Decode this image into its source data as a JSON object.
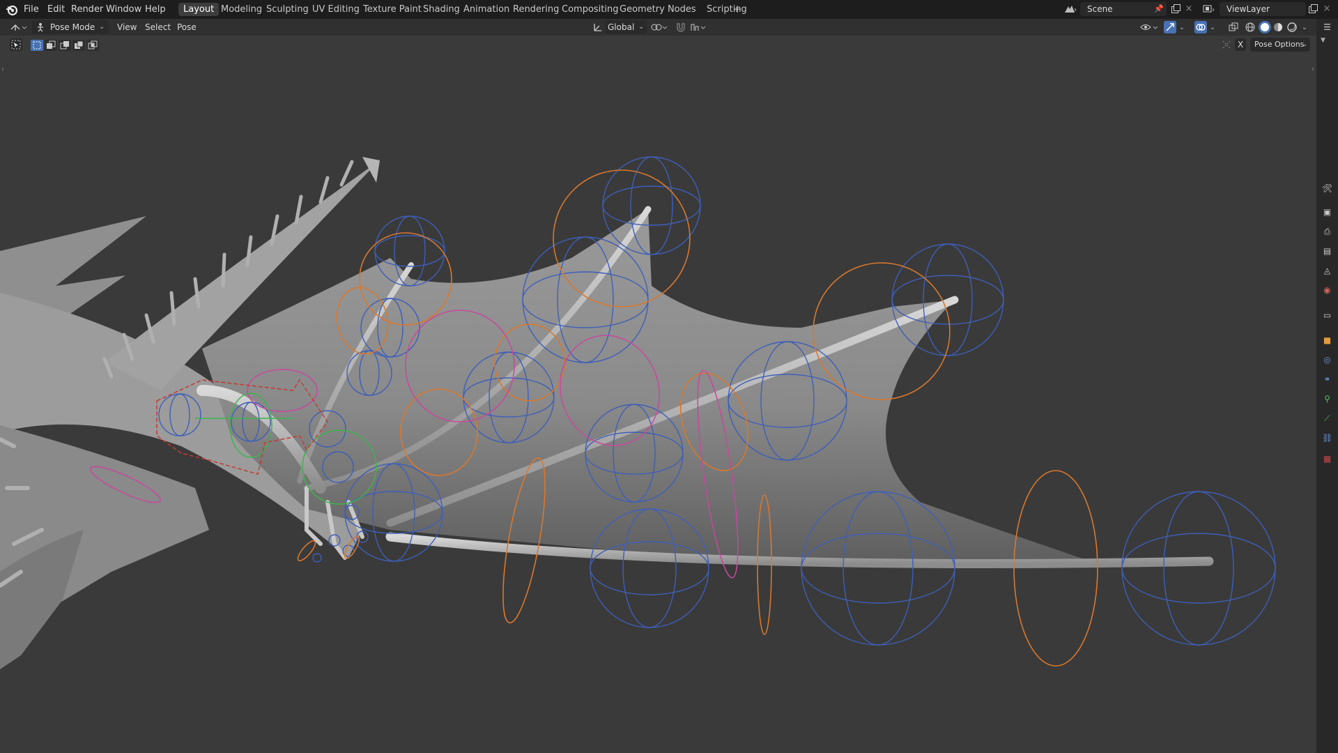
{
  "app": "Blender",
  "top_menu": [
    "File",
    "Edit",
    "Render",
    "Window",
    "Help"
  ],
  "workspaces": [
    {
      "label": "Layout",
      "active": true
    },
    {
      "label": "Modeling",
      "active": false
    },
    {
      "label": "Sculpting",
      "active": false
    },
    {
      "label": "UV Editing",
      "active": false
    },
    {
      "label": "Texture Paint",
      "active": false
    },
    {
      "label": "Shading",
      "active": false
    },
    {
      "label": "Animation",
      "active": false
    },
    {
      "label": "Rendering",
      "active": false
    },
    {
      "label": "Compositing",
      "active": false
    },
    {
      "label": "Geometry Nodes",
      "active": false
    },
    {
      "label": "Scripting",
      "active": false
    }
  ],
  "add_workspace_symbol": "+",
  "scene": {
    "label": "Scene"
  },
  "view_layer": {
    "label": "ViewLayer"
  },
  "header": {
    "mode": "Pose Mode",
    "menus": [
      "View",
      "Select",
      "Pose"
    ],
    "transform_orientation": "Global",
    "pose_options": "Pose Options",
    "x_mirror": "X"
  },
  "icons": {
    "blender_logo": "blender-logo-icon",
    "editor_type": "3d-viewport-icon",
    "pose_mode": "armature-pose-icon",
    "pivot": "transform-pivot-icon",
    "snap": "snap-magnet-icon",
    "proportional": "proportional-edit-icon",
    "visibility": "eye-icon",
    "gizmo": "gizmo-icon",
    "overlays": "overlay-icon",
    "xray": "xray-icon",
    "shading": [
      "wireframe-shading-icon",
      "solid-shading-icon",
      "material-shading-icon",
      "rendered-shading-icon"
    ]
  },
  "colors": {
    "topbar": "#1d1d1d",
    "header": "#303030",
    "viewport": "#3a3a3a",
    "active_tab": "#3d3d3d",
    "bone_blue": "#3e5fb8",
    "bone_orange": "#d9782e",
    "bone_magenta": "#c7489d",
    "bone_green": "#3bb54a",
    "bone_red": "#c43a2f"
  }
}
